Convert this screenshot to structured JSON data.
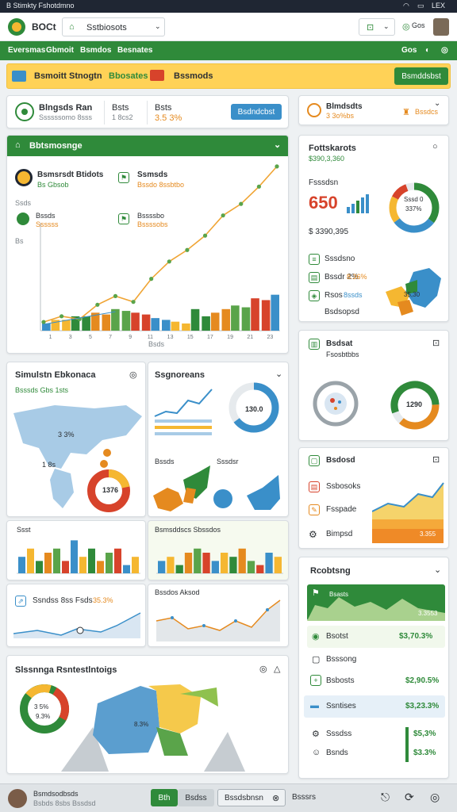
{
  "status_bar": {
    "left_text": "B Stimkty Fshotdmno",
    "right_text": "LEX"
  },
  "top_bar": {
    "app_name": "BOCt",
    "search_value": "Sstbiosots",
    "account_value": "",
    "account_label": "Gos"
  },
  "nav": {
    "items": [
      "Eversmas",
      "Gbmoit",
      "Bsmdos",
      "Besnates"
    ],
    "right_label": "Gos"
  },
  "banner": {
    "title": "Bsmoitt Stnogtn",
    "highlight": "Bbosates",
    "center": "Bssmods",
    "button": "Bsmddsbst"
  },
  "kpi_card": {
    "title": "Blngsds Ran",
    "subtitle": "Ssssssomo 8sss",
    "col2_title": "Bsts",
    "col2_value": "1 8cs2",
    "col3_title": "Bsts",
    "col3_value": "3.5 3%",
    "button": "Bsdndcbst"
  },
  "mini_card": {
    "title": "Blmdsdts",
    "subtitle": "3 3o%bs",
    "side": "Bssdcs"
  },
  "main_chart": {
    "title": "Bbtsmosnge",
    "legend1_title": "Bsmsrsdt Btidots",
    "legend1_sub": "Bs Gbsob",
    "legend2_title": "Ssmsds",
    "legend2_sub": "Bssdo 8ssbtbo",
    "legend3_title": "Bssds",
    "legend3_sub": "Ssssss",
    "legend4_title": "Bssssbo",
    "legend4_sub": "Bssssobs",
    "axis_label": "Ssds",
    "y_label": "Bs",
    "x_label": "Bsds"
  },
  "chart_data": {
    "type": "bar",
    "categories": [
      "1",
      "3",
      "5",
      "7",
      "9",
      "11",
      "13",
      "15",
      "17",
      "19",
      "21",
      "23"
    ],
    "series": [
      {
        "values": [
          4,
          6,
          8,
          9,
          11,
          9,
          6,
          4,
          8,
          12,
          13,
          17
        ]
      },
      {
        "values": [
          6,
          8,
          10,
          12,
          10,
          7,
          5,
          12,
          10,
          14,
          18,
          20
        ]
      }
    ],
    "line": [
      3,
      5,
      4,
      9,
      12,
      10,
      18,
      24,
      28,
      33,
      40,
      44,
      50,
      57
    ],
    "ylim": [
      0,
      60
    ]
  },
  "right_summary": {
    "title": "Fottskarots",
    "subtitle": "$390,3,360",
    "label1": "Fsssdsn",
    "big_value": "650",
    "pct_value": "337%",
    "amount": "$ 3390,395",
    "donut_label": "Sssd 0",
    "donut_value": "337%",
    "items": [
      "Sssdsno",
      "Bssdr 2%",
      "Rsos"
    ],
    "items_values": [
      "",
      "8.36%",
      "8ssds"
    ],
    "map_label": "Bsdsopsd",
    "map_value": "35,30"
  },
  "sim_card": {
    "title": "Simulstn Ebkonaca",
    "subtitle": "Bsssds Gbs 1sts",
    "labels": [
      "3 3%",
      "1 8s"
    ],
    "donut_value": "1376"
  },
  "mini_panels": [
    {
      "title": "Ssgnoreans",
      "value": "130.0"
    },
    {
      "title": "Bssds",
      "sub": "Sssdsr"
    }
  ],
  "mini_bar_cards": [
    {
      "title": "Ssst"
    },
    {
      "title": "Bsmsddscs Sbssdos"
    }
  ],
  "trend_cards": [
    {
      "title": "Ssndss 8ss Fsds",
      "value": "35.3%"
    },
    {
      "title": "Bssdos Aksod"
    }
  ],
  "map_card": {
    "title": "Slssnnga Rsntestlntoigs",
    "donut_value": "3 5%",
    "donut_sub": "9.3%",
    "map_label": "8.3%"
  },
  "right_mid": {
    "title": "Bsdsat",
    "subtitle": "Fsosbtbbs",
    "gauge1": "",
    "gauge2": "1290"
  },
  "right_lower": {
    "rows": [
      "Bsdosd",
      "Ssbosoks",
      "Fsspade",
      "Bimpsd"
    ],
    "area_value": "3.355"
  },
  "rooms": {
    "title": "Rcobtsng",
    "chart_label": "Bsasts",
    "chart_value": "3.3553",
    "rows": [
      {
        "label": "Bsotst",
        "value": "$3,70.3%"
      },
      {
        "label": "Bsssong",
        "value": ""
      },
      {
        "label": "Bsbosts",
        "value": "$2,90.5%"
      },
      {
        "label": "Ssntises",
        "value": "$3,23.3%"
      },
      {
        "label": "Sssdss",
        "value": "$5,3%"
      },
      {
        "label": "Bsnds",
        "value": "$3.3%"
      }
    ]
  },
  "bottom_bar": {
    "user_name": "Bsmdsodbsds",
    "user_sub": "Bsbds 8sbs Bssdsd",
    "tabs": [
      "Bth",
      "Bsdss",
      "Bssdsbnsn"
    ],
    "right_label": "Bsssrs"
  },
  "colors": {
    "green": "#2f8a3a",
    "orange": "#e58a1f",
    "blue": "#3a8fc9",
    "yellow": "#ffd257",
    "red": "#d7432b"
  },
  "icons": [
    "wifi-icon",
    "battery-icon",
    "logo-icon",
    "search-icon",
    "chevron-down-icon",
    "gear-icon",
    "bell-icon",
    "close-icon",
    "share-icon",
    "info-icon"
  ]
}
